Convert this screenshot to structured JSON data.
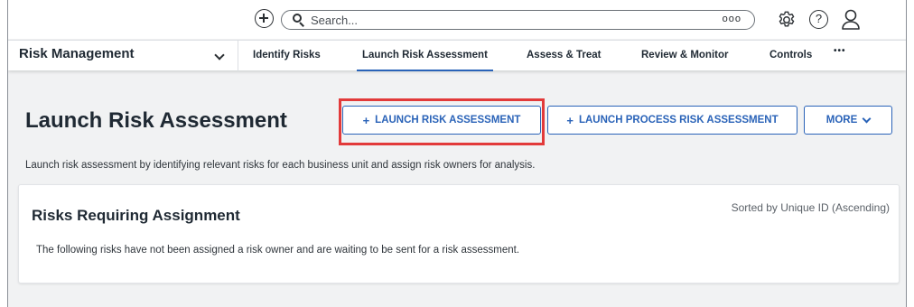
{
  "topbar": {
    "search_placeholder": "Search...",
    "search_more": "ooo"
  },
  "nav": {
    "module": "Risk Management",
    "items": [
      {
        "label": "Identify Risks"
      },
      {
        "label": "Launch Risk Assessment",
        "active": true
      },
      {
        "label": "Assess & Treat"
      },
      {
        "label": "Review & Monitor"
      },
      {
        "label": "Controls"
      }
    ],
    "more": "•••"
  },
  "page": {
    "title": "Launch Risk Assessment",
    "description": "Launch risk assessment by identifying relevant risks for each business unit and assign risk owners for analysis.",
    "buttons": {
      "launch_risk": "LAUNCH RISK ASSESSMENT",
      "launch_process": "LAUNCH PROCESS RISK ASSESSMENT",
      "more": "MORE"
    }
  },
  "card": {
    "title": "Risks Requiring Assignment",
    "sort": "Sorted by Unique ID (Ascending)",
    "text": "The following risks have not been assigned a risk owner and are waiting to be sent for a risk assessment."
  },
  "colors": {
    "accent": "#2a63b8",
    "highlight": "#e23a3a"
  }
}
